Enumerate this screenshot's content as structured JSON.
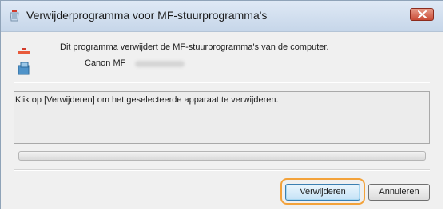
{
  "window": {
    "title": "Verwijderprogramma voor MF-stuurprogramma's",
    "close_icon": "close-x-icon"
  },
  "main": {
    "message": "Dit programma verwijdert de MF-stuurprogramma's van de computer.",
    "device_name": "Canon MF",
    "app_icon": "uninstall-icon"
  },
  "info_box": {
    "text": "Klik op [Verwijderen] om het geselecteerde apparaat te verwijderen."
  },
  "progress": {
    "value": 0
  },
  "buttons": {
    "remove_label": "Verwijderen",
    "cancel_label": "Annuleren"
  },
  "colors": {
    "highlight": "#f3a23a",
    "close_button": "#c94a35"
  }
}
